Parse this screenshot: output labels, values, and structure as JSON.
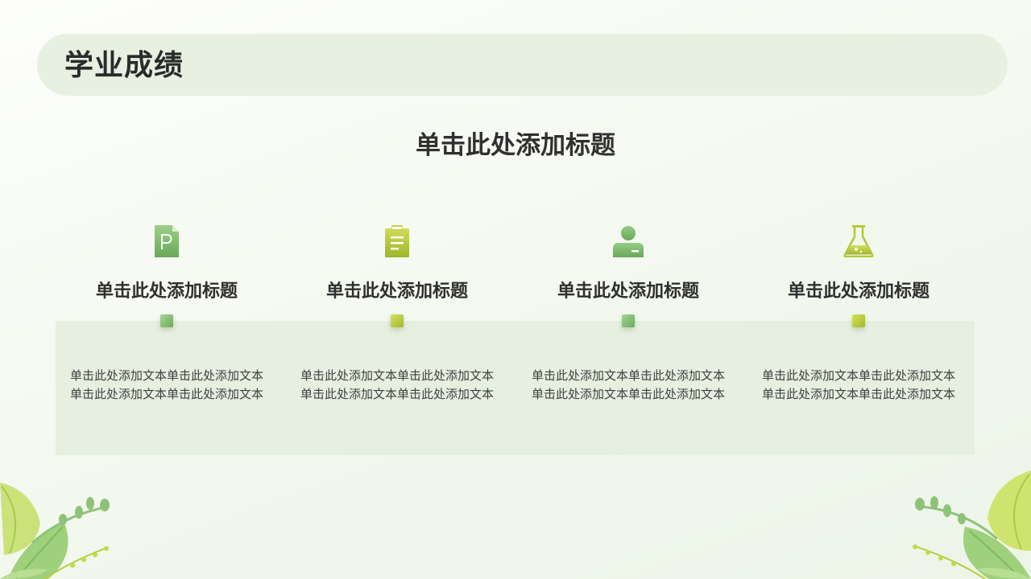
{
  "header": {
    "title": "学业成绩"
  },
  "main": {
    "subtitle": "单击此处添加标题",
    "columns": [
      {
        "icon": "document-p-icon",
        "title": "单击此处添加标题",
        "text": "单击此处添加文本单击此处添加文本单击此处添加文本单击此处添加文本"
      },
      {
        "icon": "clipboard-icon",
        "title": "单击此处添加标题",
        "text": "单击此处添加文本单击此处添加文本单击此处添加文本单击此处添加文本"
      },
      {
        "icon": "user-id-icon",
        "title": "单击此处添加标题",
        "text": "单击此处添加文本单击此处添加文本单击此处添加文本单击此处添加文本"
      },
      {
        "icon": "flask-icon",
        "title": "单击此处添加标题",
        "text": "单击此处添加文本单击此处添加文本单击此处添加文本单击此处添加文本"
      }
    ]
  },
  "colors": {
    "green": "#7eb96c",
    "olive": "#b2c53a",
    "panel": "#e6efe0",
    "header_bar": "#e7f0e1"
  }
}
